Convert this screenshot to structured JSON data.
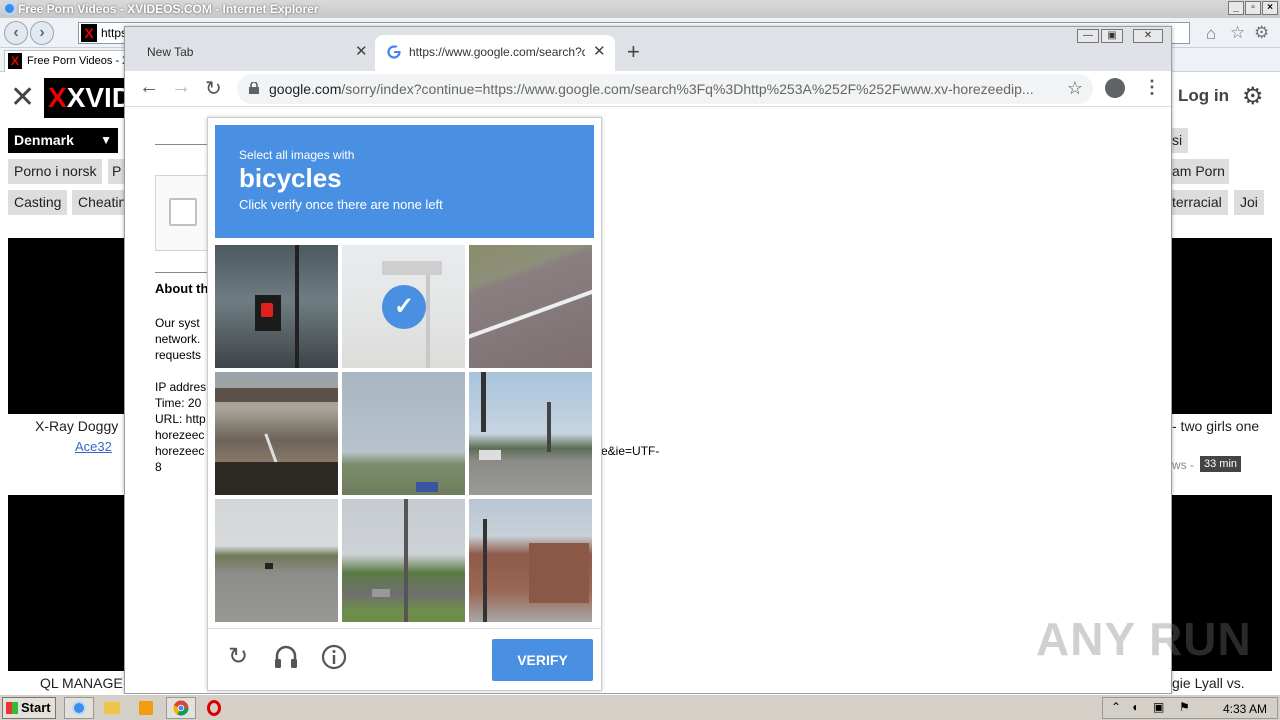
{
  "ie": {
    "title": "Free Porn Videos - XVIDEOS.COM - Internet Explorer",
    "address": "https",
    "tab_label": "Free Porn Videos - X"
  },
  "site": {
    "logo": "XVID",
    "login": "Log in",
    "country": "Denmark",
    "tags_row1": [
      "Porno i norsk",
      "P"
    ],
    "tags_row2": [
      "Casting",
      "Cheatin"
    ],
    "tags_right_row1": [
      "si"
    ],
    "tags_right_row2": [
      "am Porn"
    ],
    "tags_right_row3": [
      "terracial",
      "Joi"
    ],
    "video_left_title": "X-Ray Doggy",
    "video_left_user": "Ace32",
    "video_right_title": "- two girls one",
    "video_right_meta": "ws -",
    "video_right_duration": "33 min",
    "bottom_left_title": "QL MANAGE",
    "bottom_right_title": "gie Lyall vs."
  },
  "chrome": {
    "tab1_label": "New Tab",
    "tab2_label": "https://www.google.com/search?q=",
    "url_host": "google.com",
    "url_rest": "/sorry/index?continue=https://www.google.com/search%3Fq%3Dhttp%253A%252F%252Fwww.xv-horezeedip..."
  },
  "sorry_page": {
    "about": "About th",
    "para1": [
      "Our syst",
      "network.",
      "requests"
    ],
    "para2": [
      "IP addres",
      "Time: 20",
      "URL: http",
      "horezeec",
      "horezeec",
      "8"
    ],
    "url_tail": "e&ie=UTF-"
  },
  "captcha": {
    "instruction": "Select all images with",
    "target": "bicycles",
    "subtext": "Click verify once there are none left",
    "verify_label": "VERIFY",
    "tiles": [
      {
        "scene": "traffic signal",
        "selected": false
      },
      {
        "scene": "sidewalk pole",
        "selected": true
      },
      {
        "scene": "road edge",
        "selected": false
      },
      {
        "scene": "overpass",
        "selected": false
      },
      {
        "scene": "field sky",
        "selected": false
      },
      {
        "scene": "intersection",
        "selected": false
      },
      {
        "scene": "highway",
        "selected": false
      },
      {
        "scene": "utility pole",
        "selected": false
      },
      {
        "scene": "buildings",
        "selected": false
      }
    ]
  },
  "taskbar": {
    "start": "Start",
    "clock": "4:33 AM"
  },
  "watermark": "ANY RUN"
}
